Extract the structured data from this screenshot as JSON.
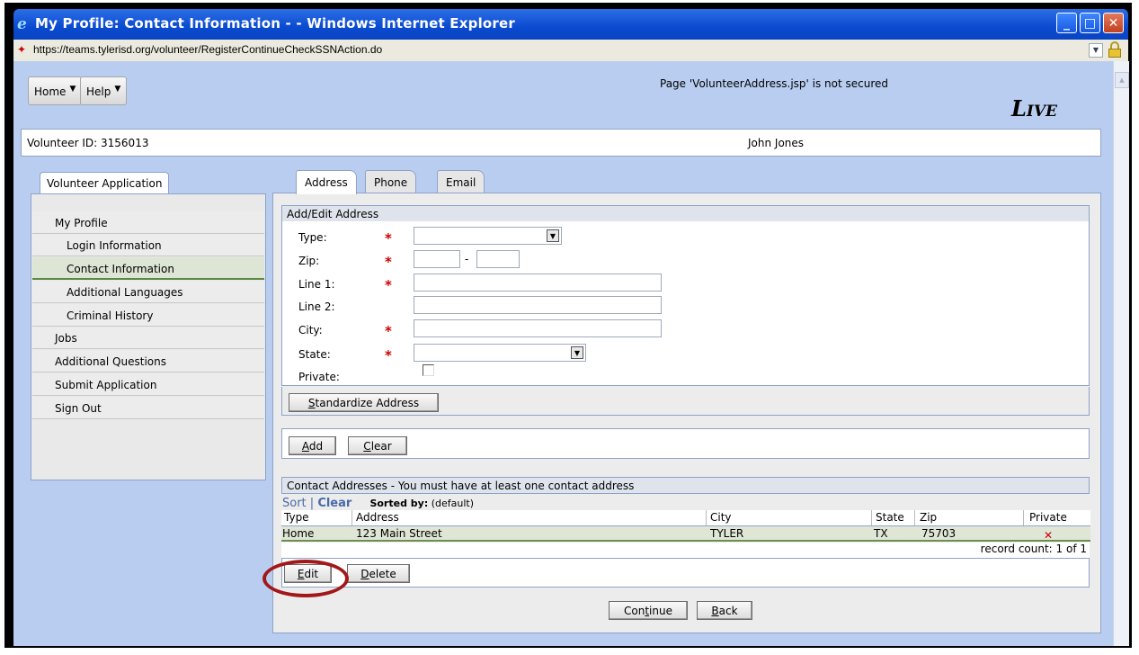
{
  "window": {
    "title": "My Profile: Contact Information - - Windows Internet Explorer",
    "url": "https://teams.tylerisd.org/volunteer/RegisterContinueCheckSSNAction.do",
    "minimize": "_",
    "maximize": "□",
    "close": "✕"
  },
  "menu": {
    "home": "Home",
    "help": "Help"
  },
  "security_note": "Page 'VolunteerAddress.jsp' is not secured",
  "logo": {
    "L": "L",
    "rest": "IVE"
  },
  "volunteer": {
    "id_text": "Volunteer ID: 3156013",
    "name": "John Jones"
  },
  "sidebar": {
    "tab": "Volunteer Application",
    "items": [
      {
        "label": "My Profile"
      },
      {
        "label": "Login Information"
      },
      {
        "label": "Contact Information"
      },
      {
        "label": "Additional Languages"
      },
      {
        "label": "Criminal History"
      },
      {
        "label": "Jobs"
      },
      {
        "label": "Additional Questions"
      },
      {
        "label": "Submit Application"
      },
      {
        "label": "Sign Out"
      }
    ]
  },
  "tabs": [
    {
      "label": "Address"
    },
    {
      "label": "Phone"
    },
    {
      "label": "Email"
    }
  ],
  "form": {
    "header": "Add/Edit Address",
    "fields": {
      "type": "Type:",
      "zip": "Zip:",
      "zip_sep": "-",
      "line1": "Line 1:",
      "line2": "Line 2:",
      "city": "City:",
      "state": "State:",
      "private": "Private:"
    },
    "required_mark": "*",
    "standardize": {
      "pre": "",
      "key": "S",
      "post": "tandardize Address"
    },
    "add": {
      "key": "A",
      "post": "dd"
    },
    "clear": {
      "key": "C",
      "post": "lear"
    }
  },
  "contacts": {
    "header": "Contact Addresses - You must have at least one contact address",
    "sort": "Sort",
    "sort_sep": " | ",
    "clear": "Clear",
    "sorted_by_label": "Sorted by:",
    "sorted_by_value": "(default)",
    "columns": [
      "Type",
      "Address",
      "City",
      "State",
      "Zip",
      "Private"
    ],
    "rows": [
      {
        "type": "Home",
        "address": "123 Main Street",
        "city": "TYLER",
        "state": "TX",
        "zip": "75703",
        "private": "✕"
      }
    ],
    "record_count": "record count: 1 of 1",
    "edit": {
      "key": "E",
      "post": "dit"
    },
    "delete": {
      "key": "D",
      "post": "elete"
    }
  },
  "footer": {
    "continue": {
      "pre": "Con",
      "key": "t",
      "post": "inue"
    },
    "back": {
      "key": "B",
      "post": "ack"
    }
  },
  "colors": {
    "titlebar": "#0a4ad0",
    "content_bg": "#b9cdf0",
    "required": "#cc0000",
    "highlight_circle": "#a2181a"
  }
}
